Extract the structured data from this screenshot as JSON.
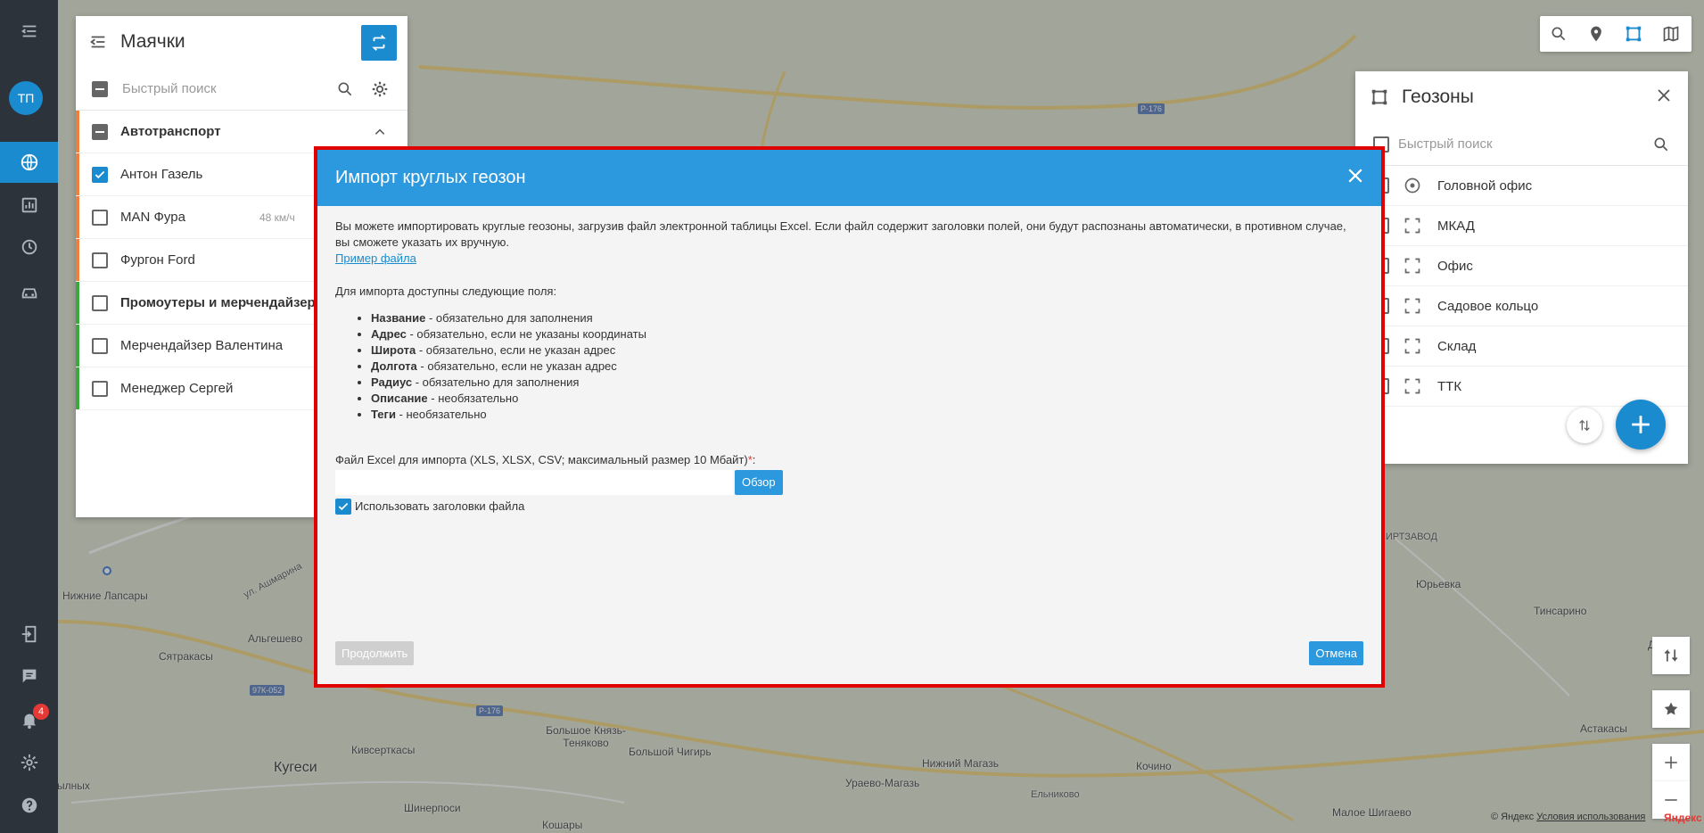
{
  "sidebar": {
    "avatar_initials": "ТП",
    "notification_count": "4"
  },
  "beacons": {
    "title": "Маячки",
    "search_placeholder": "Быстрый поиск",
    "rows": [
      {
        "label": "Автотранспорт",
        "type": "group",
        "color": "#f07f3c"
      },
      {
        "label": "Антон Газель",
        "type": "item",
        "checked": true,
        "color": "#f07f3c"
      },
      {
        "label": "MAN Фура",
        "type": "item",
        "speed": "48 км/ч",
        "color": "#f07f3c"
      },
      {
        "label": "Фургон Ford",
        "type": "item",
        "color": "#f07f3c"
      },
      {
        "label": "Промоутеры и мерчендайзеры",
        "type": "group",
        "color": "#3aa83f"
      },
      {
        "label": "Мерчендайзер Валентина",
        "type": "item",
        "color": "#3aa83f"
      },
      {
        "label": "Менеджер Сергей",
        "type": "item",
        "color": "#3aa83f"
      }
    ]
  },
  "geozones": {
    "title": "Геозоны",
    "search_placeholder": "Быстрый поиск",
    "items": [
      "Головной офис",
      "МКАД",
      "Офис",
      "Садовое кольцо",
      "Склад",
      "ТТК"
    ]
  },
  "map": {
    "labels": [
      "Р-176",
      "Р-176",
      "97К-052",
      "СПИРТЗАВОД",
      "Юрьевка",
      "Тинсарино",
      "Дуб",
      "Астакасы",
      "Кугеси",
      "Сятракасы",
      "Альгешево",
      "Нижние Лапсары",
      "Большое Князь-Теняково",
      "Большой Чигирь",
      "Кивсерткасы",
      "Шинерпоси",
      "Нижний Магазь",
      "Ураево-Магазь",
      "Кочино",
      "Ельниково",
      "Малое Шигаево",
      "Кошары",
      "ул. Ашмарина",
      "ылных"
    ],
    "copyright": "© Яндекс",
    "terms_link": "Условия использования",
    "logo": "Яндекс"
  },
  "modal": {
    "title": "Импорт круглых геозон",
    "intro": "Вы можете импортировать круглые геозоны, загрузив файл электронной таблицы Excel. Если файл содержит заголовки полей, они будут распознаны автоматически, в противном случае, вы сможете указать их вручную.",
    "sample_link": "Пример файла",
    "fields_title": "Для импорта доступны следующие поля:",
    "fields": [
      {
        "name": "Название",
        "desc": " - обязательно для заполнения"
      },
      {
        "name": "Адрес",
        "desc": " - обязательно, если не указаны координаты"
      },
      {
        "name": "Широта",
        "desc": " - обязательно, если не указан адрес"
      },
      {
        "name": "Долгота",
        "desc": " - обязательно, если не указан адрес"
      },
      {
        "name": "Радиус",
        "desc": " - обязательно для заполнения"
      },
      {
        "name": "Описание",
        "desc": " - необязательно"
      },
      {
        "name": "Теги",
        "desc": " - необязательно"
      }
    ],
    "file_label": "Файл Excel для импорта (XLS, XLSX, CSV; максимальный размер 10 Мбайт)",
    "required_mark": "*",
    "file_value": "",
    "browse_label": "Обзор",
    "use_headers_label": "Использовать заголовки файла",
    "use_headers_checked": true,
    "continue_label": "Продолжить",
    "cancel_label": "Отмена"
  },
  "colors": {
    "accent": "#2c98de",
    "modal_border": "#e00000",
    "sidebar_bg": "#2d333b"
  }
}
